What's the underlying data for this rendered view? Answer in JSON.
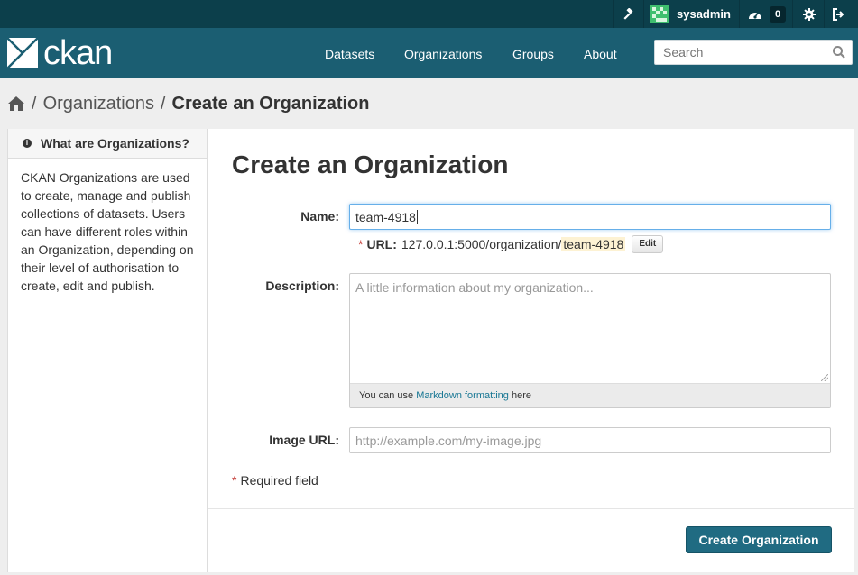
{
  "account": {
    "username": "sysadmin",
    "activity_count": "0",
    "icons": [
      "gavel-icon",
      "dashboard-icon",
      "gear-icon",
      "sign-out-icon"
    ]
  },
  "header": {
    "logo_text": "ckan",
    "nav": [
      "Datasets",
      "Organizations",
      "Groups",
      "About"
    ],
    "search_placeholder": "Search"
  },
  "breadcrumb": {
    "items": [
      "Organizations",
      "Create an Organization"
    ]
  },
  "sidebar": {
    "title": "What are Organizations?",
    "body": "CKAN Organizations are used to create, manage and publish collections of datasets. Users can have different roles within an Organization, depending on their level of authorisation to create, edit and publish."
  },
  "form": {
    "heading": "Create an Organization",
    "name_label": "Name:",
    "name_value": "team-4918",
    "url_star": "*",
    "url_label": "URL:",
    "url_prefix": "127.0.0.1:5000/organization/",
    "url_slug": "team-4918",
    "edit_label": "Edit",
    "description_label": "Description:",
    "description_placeholder": "A little information about my organization...",
    "markdown_prefix": "You can use ",
    "markdown_link": "Markdown formatting",
    "markdown_suffix": " here",
    "image_label": "Image URL:",
    "image_placeholder": "http://example.com/my-image.jpg",
    "required_star": "*",
    "required_text": "Required field",
    "submit_label": "Create Organization"
  },
  "colors": {
    "masthead": "#1b5e72",
    "account_bar": "#0c3f4b",
    "primary_button": "#206b82",
    "link": "#187794"
  }
}
